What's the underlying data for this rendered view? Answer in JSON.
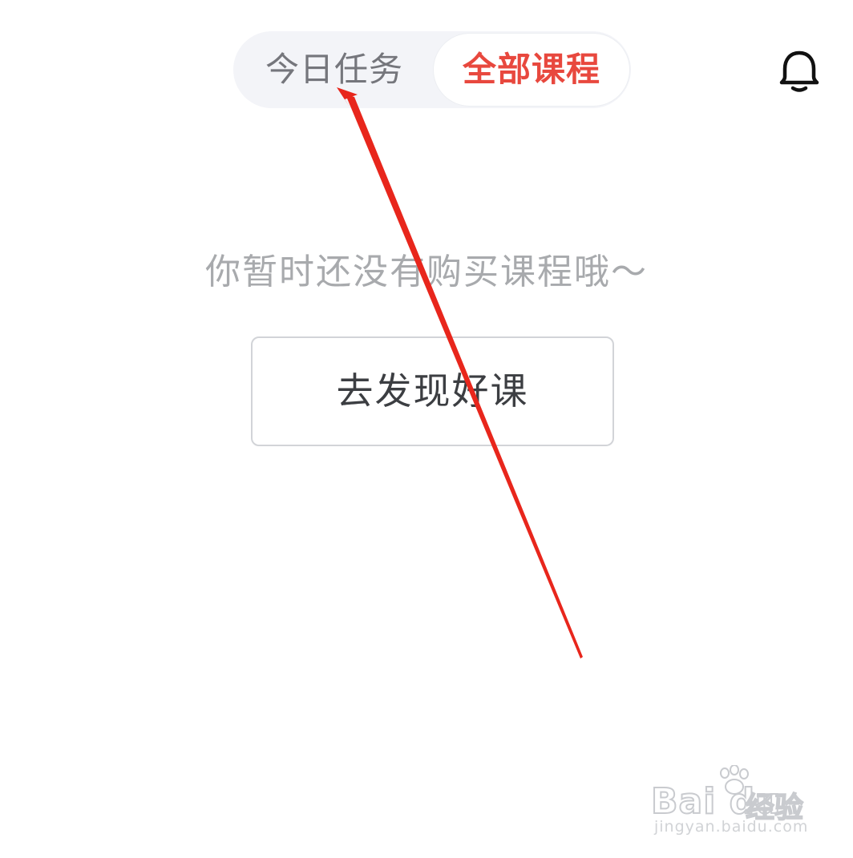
{
  "tabs": {
    "today_label": "今日任务",
    "all_label": "全部课程",
    "active": "全部课程",
    "active_color": "#e8483e"
  },
  "header": {
    "notification_icon": "bell-icon"
  },
  "empty_state": {
    "message": "你暂时还没有购买课程哦～",
    "button_label": "去发现好课"
  },
  "annotation": {
    "color": "#e8261c",
    "type": "arrow",
    "points_to": "今日任务"
  },
  "watermark": {
    "brand": "Bai du",
    "product": "经验",
    "url": "jingyan.baidu.com"
  }
}
